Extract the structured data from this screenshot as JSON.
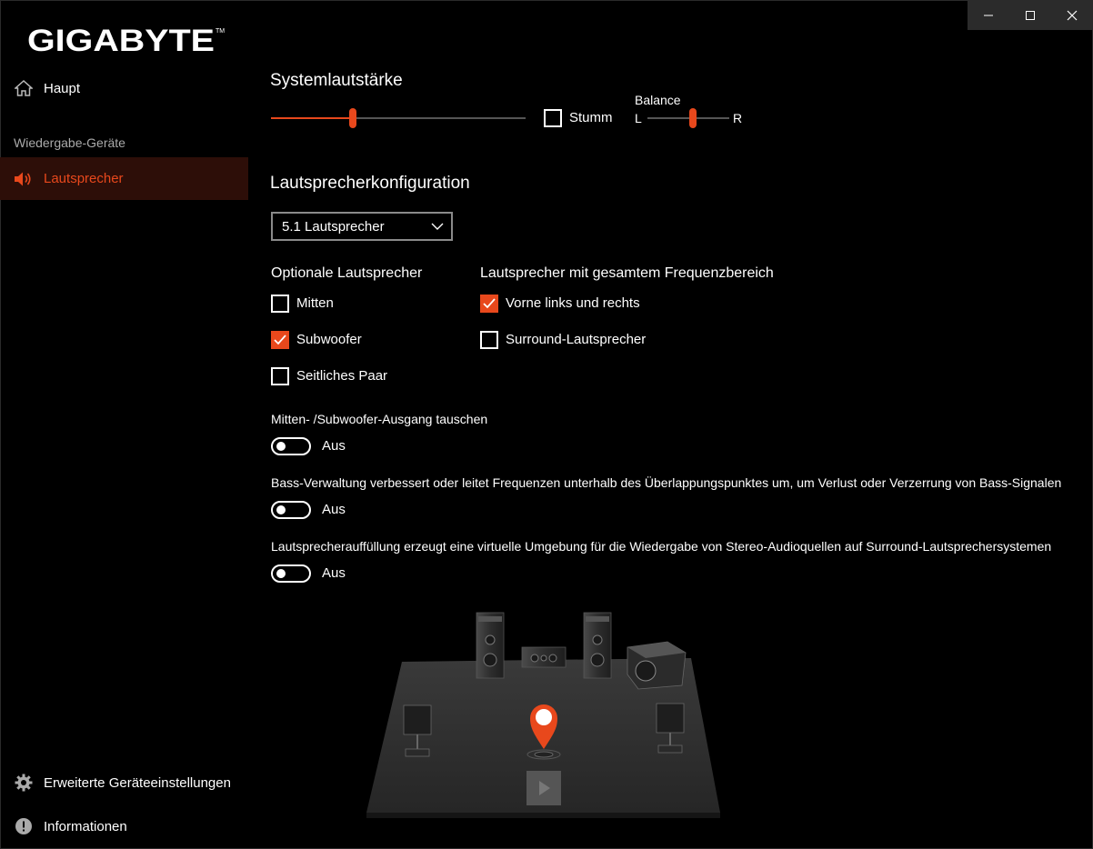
{
  "app": {
    "brand": "GIGABYTE",
    "window_controls": {
      "minimize": "minimize-icon",
      "maximize": "maximize-icon",
      "close": "close-icon"
    }
  },
  "sidebar": {
    "home": {
      "label": "Haupt",
      "icon": "home-icon"
    },
    "section_label": "Wiedergabe-Geräte",
    "speakers": {
      "label": "Lautsprecher",
      "icon": "speaker-icon",
      "active": true
    },
    "advanced": {
      "label": "Erweiterte Geräteeinstellungen",
      "icon": "gear-icon"
    },
    "info": {
      "label": "Informationen",
      "icon": "info-icon"
    }
  },
  "system_volume": {
    "title": "Systemlautstärke",
    "level": 0.32,
    "mute_label": "Stumm",
    "muted": false,
    "balance_label": "Balance",
    "balance_left": "L",
    "balance_right": "R",
    "balance_position": 0.55
  },
  "speaker_config": {
    "title": "Lautsprecherkonfiguration",
    "selected": "5.1 Lautsprecher",
    "optional_title": "Optionale Lautsprecher",
    "optional": [
      {
        "label": "Mitten",
        "checked": false
      },
      {
        "label": "Subwoofer",
        "checked": true
      },
      {
        "label": "Seitliches Paar",
        "checked": false
      }
    ],
    "fullrange_title": "Lautsprecher mit gesamtem Frequenzbereich",
    "fullrange": [
      {
        "label": "Vorne links und rechts",
        "checked": true
      },
      {
        "label": "Surround-Lautsprecher",
        "checked": false
      }
    ]
  },
  "toggles": [
    {
      "description": "Mitten- /Subwoofer-Ausgang tauschen",
      "state": "Aus"
    },
    {
      "description": "Bass-Verwaltung verbessert oder leitet Frequenzen unterhalb des Überlappungspunktes um, um Verlust oder Verzerrung von Bass-Signalen",
      "state": "Aus"
    },
    {
      "description": "Lautsprecherauffüllung erzeugt eine virtuelle Umgebung für die Wiedergabe von Stereo-Audioquellen auf Surround-Lautsprechersystemen",
      "state": "Aus"
    }
  ],
  "colors": {
    "accent": "#e8481c",
    "background": "#000000",
    "active_nav_bg": "#2d0e08"
  }
}
